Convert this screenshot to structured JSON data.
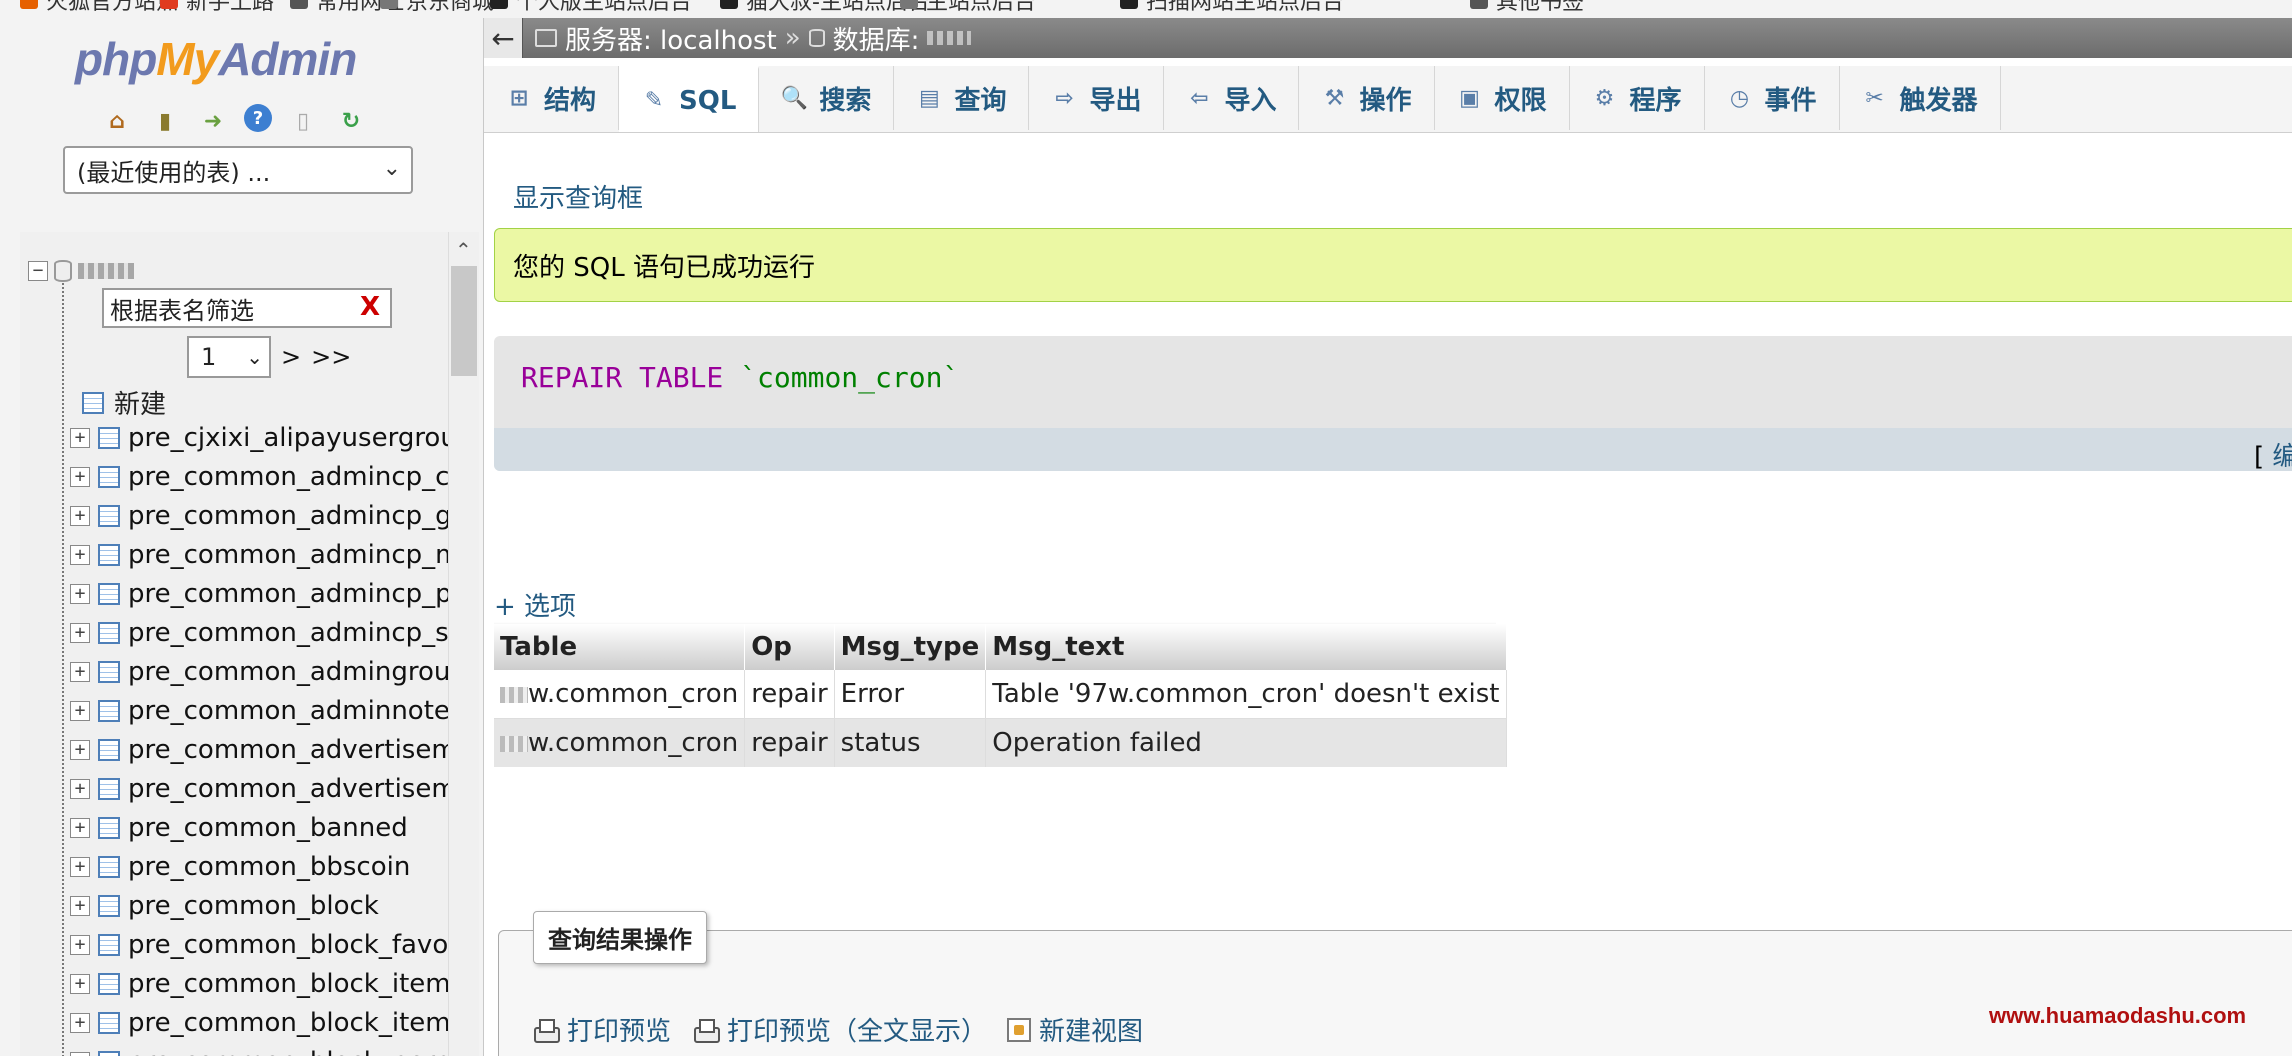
{
  "bookmarks": [
    {
      "label": "火狐官方站点",
      "color": "#e66000"
    },
    {
      "label": "新手上路",
      "color": "#e03b1f"
    },
    {
      "label": "常用网址",
      "color": "#555555"
    },
    {
      "label": "京东商城",
      "color": "#777777"
    },
    {
      "label": "个人版主站点后台",
      "color": "#222222"
    },
    {
      "label": "猫大叔-主站点后台",
      "color": "#222222"
    },
    {
      "label": "主站点后台",
      "color": "#777777"
    },
    {
      "label": "扫描网站主站点后台",
      "color": "#222222"
    },
    {
      "label": "其他书签",
      "color": "#555555"
    }
  ],
  "logo": {
    "php": "php",
    "my": "My",
    "admin": "Admin"
  },
  "nav": {
    "recent_tables": "(最近使用的表) ...",
    "filter_value": "根据表名筛选",
    "filter_clear": "X",
    "page": "1",
    "page_next": ">",
    "page_last": ">>",
    "new_label": "新建",
    "tables": [
      "pre_cjxixi_alipayusergroup",
      "pre_common_admincp_cmenu",
      "pre_common_admincp_group",
      "pre_common_admincp_member",
      "pre_common_admincp_perm",
      "pre_common_admincp_session",
      "pre_common_admingroup",
      "pre_common_adminnote",
      "pre_common_advertisement",
      "pre_common_advertisement_custom",
      "pre_common_banned",
      "pre_common_bbscoin",
      "pre_common_block",
      "pre_common_block_favorite",
      "pre_common_block_item",
      "pre_common_block_item_data",
      "pre_common_block_permission"
    ]
  },
  "breadcrumb": {
    "back": "←",
    "server": "服务器: localhost",
    "sep": "»",
    "database": "数据库:"
  },
  "tabs": [
    {
      "label": "结构",
      "icon": "structure-icon",
      "glyph": "⊞"
    },
    {
      "label": "SQL",
      "icon": "sql-icon",
      "glyph": "✎",
      "active": true
    },
    {
      "label": "搜索",
      "icon": "search-icon",
      "glyph": "🔍"
    },
    {
      "label": "查询",
      "icon": "query-icon",
      "glyph": "▤"
    },
    {
      "label": "导出",
      "icon": "export-icon",
      "glyph": "⇨"
    },
    {
      "label": "导入",
      "icon": "import-icon",
      "glyph": "⇦"
    },
    {
      "label": "操作",
      "icon": "wrench-icon",
      "glyph": "⚒"
    },
    {
      "label": "权限",
      "icon": "privileges-icon",
      "glyph": "▣"
    },
    {
      "label": "程序",
      "icon": "routines-icon",
      "glyph": "⚙"
    },
    {
      "label": "事件",
      "icon": "clock-icon",
      "glyph": "◷"
    },
    {
      "label": "触发器",
      "icon": "triggers-icon",
      "glyph": "✂"
    }
  ],
  "show_query_box": "显示查询框",
  "success_message": "您的 SQL 语句已成功运行",
  "sql": {
    "keyword": "REPAIR TABLE",
    "identifier": "`common_cron`"
  },
  "edit_link": {
    "bracket": "[",
    "label": "编辑"
  },
  "options_link": "+ 选项",
  "results": {
    "headers": [
      "Table",
      "Op",
      "Msg_type",
      "Msg_text"
    ],
    "rows": [
      {
        "table": "w.common_cron",
        "op": "repair",
        "msg_type": "Error",
        "msg_text": "Table '97w.common_cron' doesn't exist"
      },
      {
        "table": "w.common_cron",
        "op": "repair",
        "msg_type": "status",
        "msg_text": "Operation failed"
      }
    ]
  },
  "query_ops": {
    "legend": "查询结果操作",
    "print_preview": "打印预览",
    "print_preview_full": "打印预览（全文显示）",
    "create_view": "新建视图"
  },
  "watermark": "www.huamaodashu.com",
  "colors": {
    "link": "#235a81",
    "success_bg": "#ebf8a4",
    "sql_keyword": "#990099",
    "sql_identifier": "#008000"
  }
}
